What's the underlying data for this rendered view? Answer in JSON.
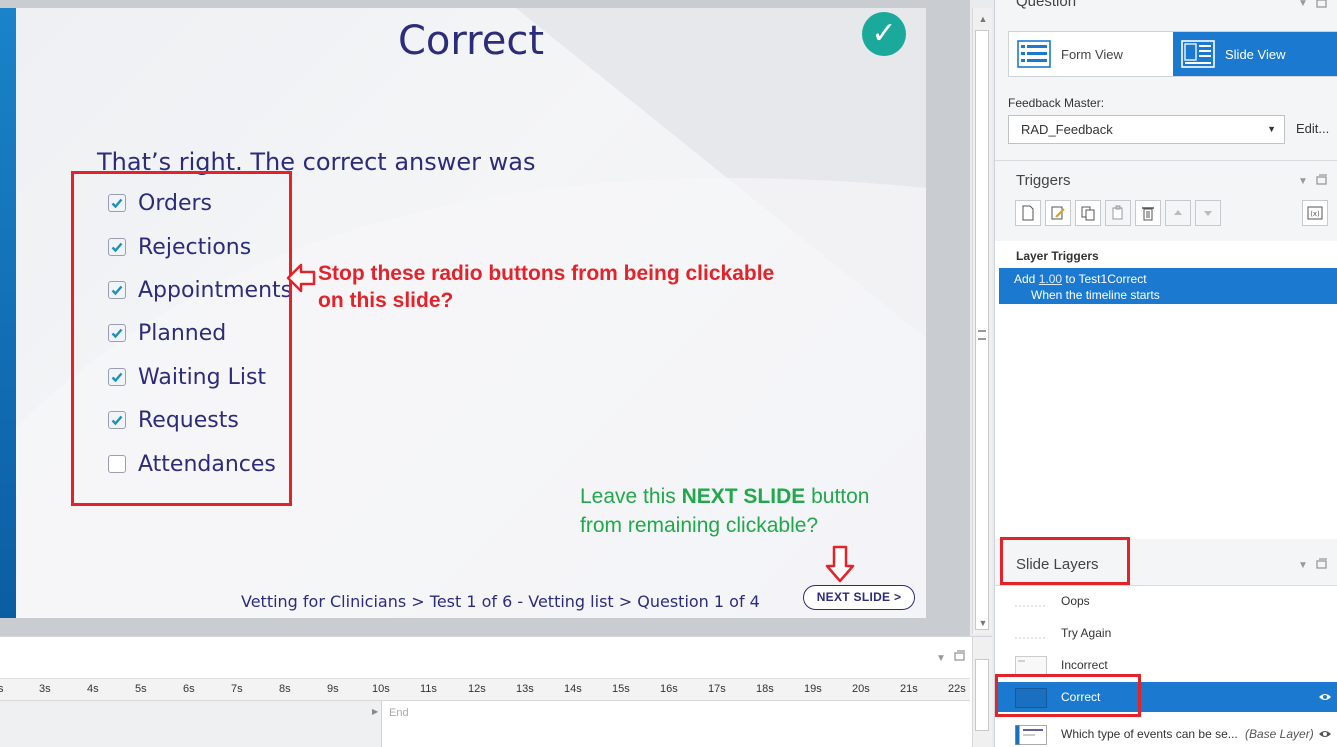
{
  "slide": {
    "title": "Correct",
    "feedback_text": "That’s right. The correct answer was",
    "answers": [
      {
        "label": "Orders",
        "checked": true
      },
      {
        "label": "Rejections",
        "checked": true
      },
      {
        "label": "Appointments",
        "checked": true
      },
      {
        "label": "Planned",
        "checked": true
      },
      {
        "label": "Waiting List",
        "checked": true
      },
      {
        "label": "Requests",
        "checked": true
      },
      {
        "label": "Attendances",
        "checked": false
      }
    ],
    "breadcrumb": "Vetting for Clinicians > Test 1 of 6 - Vetting list > Question 1 of 4",
    "next_button": "NEXT SLIDE >"
  },
  "annotations": {
    "red_line1": "Stop these radio buttons from being clickable",
    "red_line2": "on this slide?",
    "green_pre": "Leave this ",
    "green_bold": "NEXT SLIDE",
    "green_post": " button",
    "green_line2": "from remaining clickable?"
  },
  "timeline": {
    "ticks": [
      "3s",
      "4s",
      "5s",
      "6s",
      "7s",
      "8s",
      "9s",
      "10s",
      "11s",
      "12s",
      "13s",
      "14s",
      "15s",
      "16s",
      "17s",
      "18s",
      "19s",
      "20s",
      "21s",
      "22s"
    ],
    "end_label": "End"
  },
  "panel": {
    "question_title": "Question",
    "form_view": "Form View",
    "slide_view": "Slide View",
    "feedback_master_label": "Feedback Master:",
    "feedback_master_value": "RAD_Feedback",
    "edit_label": "Edit...",
    "triggers_title": "Triggers",
    "layer_triggers_title": "Layer Triggers",
    "trigger": {
      "prefix": "Add ",
      "value": "1.00",
      "suffix": " to Test1Correct",
      "condition": "When the timeline starts"
    },
    "slide_layers_title": "Slide Layers",
    "layers": [
      {
        "name": "Oops"
      },
      {
        "name": "Try Again"
      },
      {
        "name": "Incorrect"
      },
      {
        "name": "Correct"
      },
      {
        "name": "Which type of events can be se...",
        "tag": "(Base Layer)"
      }
    ]
  },
  "colors": {
    "accent_blue": "#1b7ad0",
    "annotation_red": "#e3232a",
    "annotation_green": "#21a84a",
    "slide_text": "#2d2c7a",
    "correct_badge": "#1aa99a"
  }
}
